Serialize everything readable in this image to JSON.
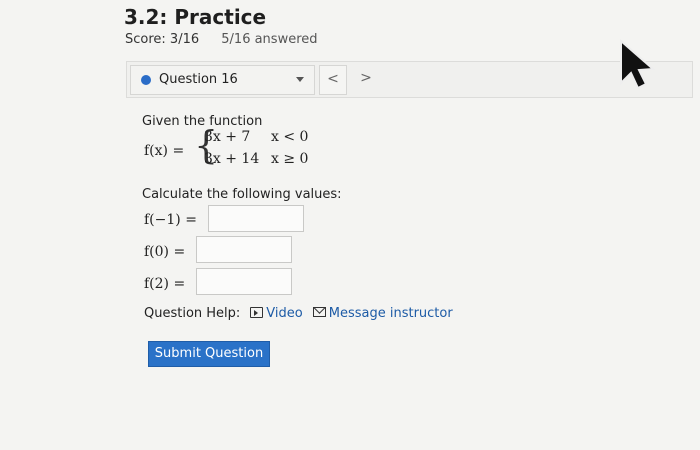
{
  "header": {
    "title": "3.2: Practice",
    "score": "Score: 3/16",
    "answered": "5/16 answered"
  },
  "question_bar": {
    "selected": "Question 16",
    "prev": "<",
    "next": ">"
  },
  "question": {
    "intro": "Given the function",
    "fx": "f(x) =",
    "pieces": [
      {
        "expr": "3x + 7",
        "cond": "x < 0"
      },
      {
        "expr": "3x + 14",
        "cond": "x ≥ 0"
      }
    ],
    "calc_prompt": "Calculate the following values:",
    "rows": [
      {
        "label": "f(−1) =",
        "value": ""
      },
      {
        "label": "f(0) =",
        "value": ""
      },
      {
        "label": "f(2) =",
        "value": ""
      }
    ]
  },
  "help": {
    "label": "Question Help:",
    "video": "Video",
    "message": "Message instructor"
  },
  "submit": "Submit Question",
  "colors": {
    "accent": "#2a72c8",
    "link": "#1d5ba6",
    "dot": "#2a6cc7"
  },
  "icons": [
    "dropdown-caret-icon",
    "cursor-arrow-icon",
    "video-icon",
    "mail-icon"
  ]
}
